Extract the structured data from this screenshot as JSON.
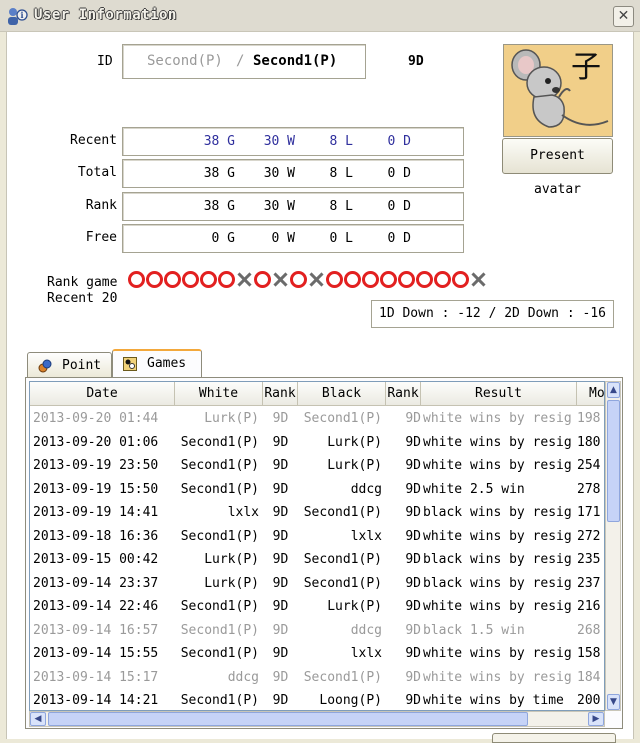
{
  "window": {
    "title": "User Information",
    "close_glyph": "✕"
  },
  "profile": {
    "id_label": "ID",
    "id_first": "Second(P)",
    "id_separator": "/",
    "id_second": "Second1(P)",
    "rank": "9D",
    "avatar_char": "子",
    "present_avatar_label": "Present avatar"
  },
  "stats": {
    "rows": [
      {
        "label": "Recent",
        "g": "38 G",
        "w": "30 W",
        "l": "8 L",
        "d": "0 D"
      },
      {
        "label": "Total",
        "g": "38 G",
        "w": "30 W",
        "l": "8 L",
        "d": "0 D"
      },
      {
        "label": "Rank",
        "g": "38 G",
        "w": "30 W",
        "l": "8 L",
        "d": "0 D"
      },
      {
        "label": "Free",
        "g": "0 G",
        "w": "0 W",
        "l": "0 L",
        "d": "0 D"
      }
    ]
  },
  "rank_game": {
    "label_line1": "Rank game",
    "label_line2": "Recent 20",
    "sequence": [
      "o",
      "o",
      "o",
      "o",
      "o",
      "o",
      "x",
      "o",
      "x",
      "o",
      "x",
      "o",
      "o",
      "o",
      "o",
      "o",
      "o",
      "o",
      "o",
      "x"
    ],
    "win_color": "#e22020",
    "loss_color": "#6b6b6b"
  },
  "down_info": "1D Down : -12 / 2D Down : -16",
  "tabs": [
    {
      "label": "Point",
      "icon": "point-icon"
    },
    {
      "label": "Games",
      "icon": "games-icon",
      "selected": true
    }
  ],
  "games_table": {
    "columns": [
      "Date",
      "White",
      "Rank",
      "Black",
      "Rank",
      "Result",
      "Mo"
    ],
    "rows": [
      {
        "dim": true,
        "date": "2013-09-20 01:44",
        "white": "Lurk(P)",
        "wrank": "9D",
        "black": "Second1(P)",
        "brank": "9D",
        "result": "white wins by resig",
        "moves": "198"
      },
      {
        "dim": false,
        "date": "2013-09-20 01:06",
        "white": "Second1(P)",
        "wrank": "9D",
        "black": "Lurk(P)",
        "brank": "9D",
        "result": "white wins by resig",
        "moves": "180"
      },
      {
        "dim": false,
        "date": "2013-09-19 23:50",
        "white": "Second1(P)",
        "wrank": "9D",
        "black": "Lurk(P)",
        "brank": "9D",
        "result": "white wins by resig",
        "moves": "254"
      },
      {
        "dim": false,
        "date": "2013-09-19 15:50",
        "white": "Second1(P)",
        "wrank": "9D",
        "black": "ddcg",
        "brank": "9D",
        "result": "white 2.5 win",
        "moves": "278"
      },
      {
        "dim": false,
        "date": "2013-09-19 14:41",
        "white": "lxlx",
        "wrank": "9D",
        "black": "Second1(P)",
        "brank": "9D",
        "result": "black wins by resig",
        "moves": "171"
      },
      {
        "dim": false,
        "date": "2013-09-18 16:36",
        "white": "Second1(P)",
        "wrank": "9D",
        "black": "lxlx",
        "brank": "9D",
        "result": "white wins by resig",
        "moves": "272"
      },
      {
        "dim": false,
        "date": "2013-09-15 00:42",
        "white": "Lurk(P)",
        "wrank": "9D",
        "black": "Second1(P)",
        "brank": "9D",
        "result": "black wins by resig",
        "moves": "235"
      },
      {
        "dim": false,
        "date": "2013-09-14 23:37",
        "white": "Lurk(P)",
        "wrank": "9D",
        "black": "Second1(P)",
        "brank": "9D",
        "result": "black wins by resig",
        "moves": "237"
      },
      {
        "dim": false,
        "date": "2013-09-14 22:46",
        "white": "Second1(P)",
        "wrank": "9D",
        "black": "Lurk(P)",
        "brank": "9D",
        "result": "white wins by resig",
        "moves": "216"
      },
      {
        "dim": true,
        "date": "2013-09-14 16:57",
        "white": "Second1(P)",
        "wrank": "9D",
        "black": "ddcg",
        "brank": "9D",
        "result": "black 1.5 win",
        "moves": "268"
      },
      {
        "dim": false,
        "date": "2013-09-14 15:55",
        "white": "Second1(P)",
        "wrank": "9D",
        "black": "lxlx",
        "brank": "9D",
        "result": "white wins by resig",
        "moves": "158"
      },
      {
        "dim": true,
        "date": "2013-09-14 15:17",
        "white": "ddcg",
        "wrank": "9D",
        "black": "Second1(P)",
        "brank": "9D",
        "result": "white wins by resig",
        "moves": "184"
      },
      {
        "dim": false,
        "date": "2013-09-14 14:21",
        "white": "Second1(P)",
        "wrank": "9D",
        "black": "Loong(P)",
        "brank": "9D",
        "result": "white wins by time",
        "moves": "200"
      }
    ]
  }
}
